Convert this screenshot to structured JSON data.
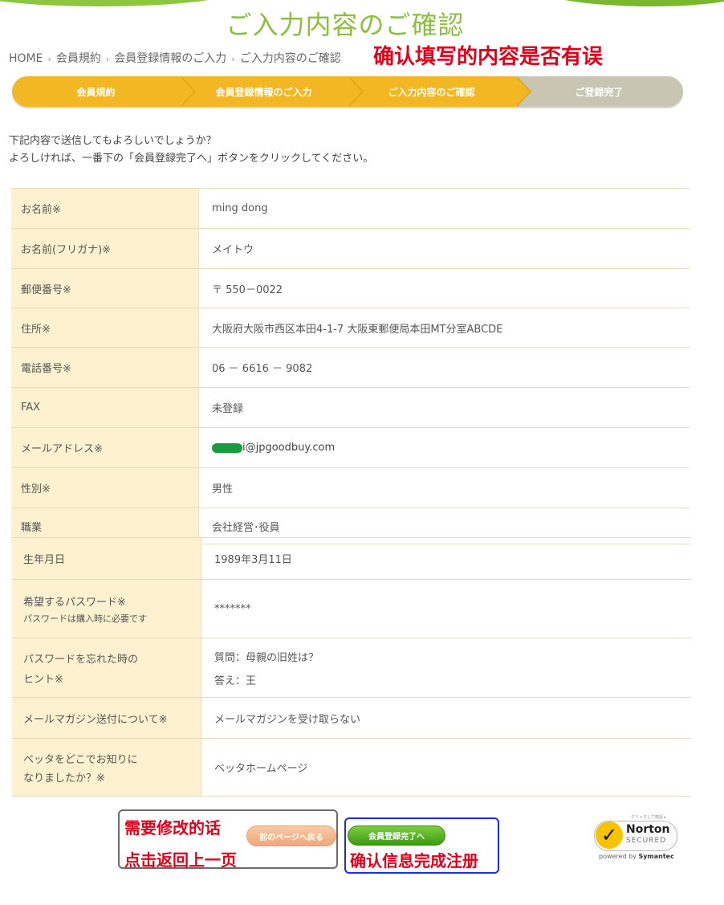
{
  "page": {
    "title": "ご入力内容のご確認"
  },
  "breadcrumb": [
    "HOME",
    "会員規約",
    "会員登録情報のご入力",
    "ご入力内容のご確認"
  ],
  "breadcrumb_separator": "›",
  "annotations": {
    "top": "确认填写的内容是否有误",
    "modify": "需要修改的话",
    "go_back": "点击返回上一页",
    "confirm": "确认信息完成注册"
  },
  "steps": [
    {
      "label": "会員規約",
      "active": true
    },
    {
      "label": "会員登録情報のご入力",
      "active": true
    },
    {
      "label": "ご入力内容のご確認",
      "active": true
    },
    {
      "label": "ご登録完了",
      "active": false
    }
  ],
  "intro": {
    "line1": "下記内容で送信してもよろしいでしょうか？",
    "line2": "よろしければ、一番下の「会員登録完了へ」ボタンをクリックしてください。"
  },
  "fields": {
    "name": {
      "label": "お名前※",
      "value": "ming dong"
    },
    "kana": {
      "label": "お名前(フリガナ)※",
      "value": "メイトウ"
    },
    "zip": {
      "label": "郵便番号※",
      "value": "〒 550－0022"
    },
    "address": {
      "label": "住所※",
      "value": "大阪府大阪市西区本田4-1-7 大阪東郵便局本田MT分室ABCDE"
    },
    "phone": {
      "label": "電話番号※",
      "value": "06 － 6616 － 9082"
    },
    "fax": {
      "label": "FAX",
      "value": "未登録"
    },
    "email": {
      "label": "メールアドレス※",
      "value": "i@jpgoodbuy.com"
    },
    "gender": {
      "label": "性別※",
      "value": "男性"
    },
    "job": {
      "label": "職業",
      "value": "会社経営･役員"
    },
    "birthday": {
      "label": "生年月日",
      "value": "1989年3月11日"
    },
    "password": {
      "label": "希望するパスワード※",
      "sub": "パスワードは購入時に必要です",
      "value": "*******"
    },
    "hint": {
      "label1": "パスワードを忘れた時の",
      "label2": "ヒント※",
      "question": "質問：母親の旧姓は？",
      "answer": "答え：王"
    },
    "magazine": {
      "label": "メールマガジン送付について※",
      "value": "メールマガジンを受け取らない"
    },
    "source": {
      "label1": "ベッタをどこでお知りに",
      "label2": "なりましたか？※",
      "value": "ベッタホームページ"
    }
  },
  "buttons": {
    "back": "前のページへ戻る",
    "finish": "会員登録完了へ"
  },
  "norton": {
    "tiny": "クリックして検証 ▸",
    "brand": "Norton",
    "secured": "SECURED",
    "powered_prefix": "powered by",
    "powered_brand": "Symantec"
  },
  "colors": {
    "title_green": "#8cbf3c",
    "step_active": "#f3b723",
    "step_inactive": "#c8c5b3",
    "label_bg": "#fdf1cf",
    "annotation_red": "#e0001a",
    "box_blue": "#1a2ee6"
  }
}
